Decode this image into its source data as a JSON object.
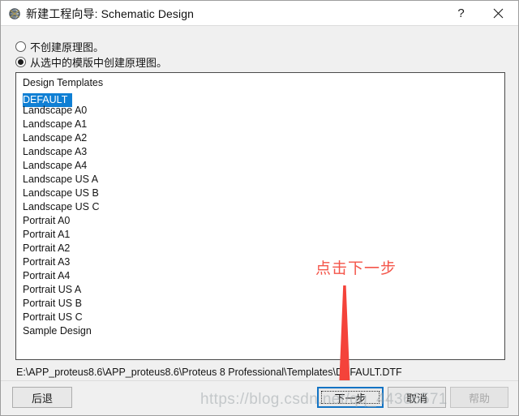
{
  "window": {
    "title": "新建工程向导: Schematic Design",
    "icon": "proteus-globe-icon",
    "help_label": "?",
    "close_label": "✕"
  },
  "options": {
    "no_schematic": {
      "label": "不创建原理图。",
      "selected": false
    },
    "from_template": {
      "label": "从选中的模版中创建原理图。",
      "selected": true
    }
  },
  "template_list": {
    "header": "Design Templates",
    "selected": "DEFAULT",
    "items": [
      "DEFAULT",
      "Landscape A0",
      "Landscape A1",
      "Landscape A2",
      "Landscape A3",
      "Landscape A4",
      "Landscape US A",
      "Landscape US B",
      "Landscape US C",
      "Portrait A0",
      "Portrait A1",
      "Portrait A2",
      "Portrait A3",
      "Portrait A4",
      "Portrait US A",
      "Portrait US B",
      "Portrait US C",
      "Sample Design"
    ]
  },
  "path": "E:\\APP_proteus8.6\\APP_proteus8.6\\Proteus 8 Professional\\Templates\\DEFAULT.DTF",
  "footer": {
    "back_label": "后退",
    "next_label": "下一步",
    "cancel_label": "取消",
    "help_label": "帮助"
  },
  "annotation": {
    "text": "点击下一步",
    "color": "#f4554a"
  },
  "watermark": {
    "text": "https://blog.csdn.net/qq_44366571"
  },
  "colors": {
    "selection_blue": "#0f7fd4",
    "focus_blue": "#1273c4",
    "dialog_bg": "#f0f0f0",
    "annotation_red": "#f4554a"
  }
}
